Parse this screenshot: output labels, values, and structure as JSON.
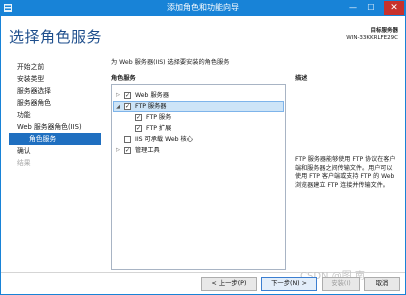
{
  "window": {
    "title": "添加角色和功能向导",
    "minimize_glyph": "—",
    "maximize_glyph": "☐",
    "close_glyph": "✕"
  },
  "header": {
    "page_title": "选择角色服务",
    "target_label": "目标服务器",
    "target_server": "WIN-33KKRLFE29C"
  },
  "nav": {
    "items": [
      {
        "label": "开始之前",
        "state": "normal"
      },
      {
        "label": "安装类型",
        "state": "normal"
      },
      {
        "label": "服务器选择",
        "state": "normal"
      },
      {
        "label": "服务器角色",
        "state": "normal"
      },
      {
        "label": "功能",
        "state": "normal"
      },
      {
        "label": "Web 服务器角色(IIS)",
        "state": "normal"
      },
      {
        "label": "角色服务",
        "state": "active"
      },
      {
        "label": "确认",
        "state": "normal"
      },
      {
        "label": "结果",
        "state": "disabled"
      }
    ]
  },
  "main": {
    "instruction": "为 Web 服务器(IIS) 选择要安装的角色服务",
    "roles_header": "角色服务",
    "description_header": "描述",
    "roles": [
      {
        "label": "Web 服务器",
        "expander": "▷",
        "checked": true
      },
      {
        "label": "FTP 服务器",
        "expander": "◢",
        "checked": true,
        "selected": true
      },
      {
        "label": "FTP 服务",
        "expander": "",
        "checked": true
      },
      {
        "label": "FTP 扩展",
        "expander": "",
        "checked": true
      },
      {
        "label": "IIS 可承载 Web 核心",
        "expander": "",
        "checked": false
      },
      {
        "label": "管理工具",
        "expander": "▷",
        "checked": true
      }
    ],
    "description": "FTP 服务器能够使用 FTP 协议在客户端和服务器之间传输文件。用户可以使用 FTP 客户端或支持 FTP 的 Web 浏览器建立 FTP 连接并传输文件。"
  },
  "footer": {
    "prev_label": "< 上一步(P)",
    "next_label": "下一步(N) >",
    "install_label": "安装(I)",
    "cancel_label": "取消"
  },
  "watermark": "CSDN @图 南",
  "colors": {
    "title_bar": "#1883d7",
    "nav_active": "#1f6fc0",
    "page_title": "#1e4e8c",
    "selected_row": "#cde4f7"
  }
}
